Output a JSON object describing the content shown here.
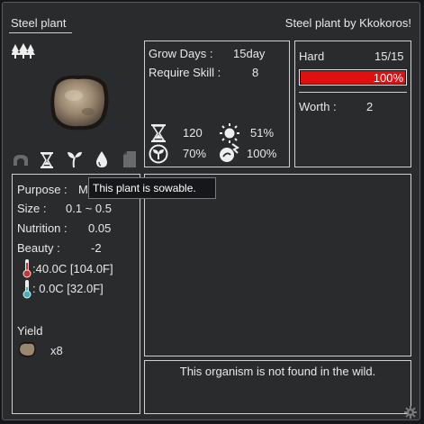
{
  "window": {
    "title": "Steel plant",
    "credit": "Steel plant by Kkokoros!"
  },
  "icons": {
    "category": "trees-icon",
    "plant": "ore-rock-image",
    "tabs": [
      "cave-icon",
      "hourglass-icon",
      "sprout-icon",
      "water-drop-icon",
      "document-icon"
    ],
    "gear": "gear-icon"
  },
  "growth": {
    "grow_days_label": "Grow Days :",
    "grow_days_value": "15day",
    "require_skill_label": "Require Skill :",
    "require_skill_value": "8",
    "stats": [
      {
        "icon": "hourglass-icon",
        "value": "120"
      },
      {
        "icon": "sun-icon",
        "value": "51%"
      },
      {
        "icon": "seed-icon",
        "value": "70%"
      },
      {
        "icon": "fertilizer-icon",
        "value": "100%"
      }
    ]
  },
  "hardness": {
    "label": "Hard",
    "value": "15/15",
    "percent_text": "100%",
    "fill_fraction": 1.0,
    "worth_label": "Worth :",
    "worth_value": "2",
    "colors": {
      "fill": "#e01010"
    }
  },
  "tooltip": {
    "text": "This plant is sowable."
  },
  "details": {
    "purpose_label": "Purpose :",
    "purpose_value": "M",
    "size_label": "Size :",
    "size_value": "0.1 ~ 0.5",
    "nutrition_label": "Nutrition :",
    "nutrition_value": "0.05",
    "beauty_label": "Beauty :",
    "beauty_value": "-2",
    "temp_max": ":40.0C [104.0F]",
    "temp_min": ":  0.0C [32.0F]",
    "yield_label": "Yield",
    "yield_value": "x8"
  },
  "wild_note": "This organism is not found in the wild."
}
